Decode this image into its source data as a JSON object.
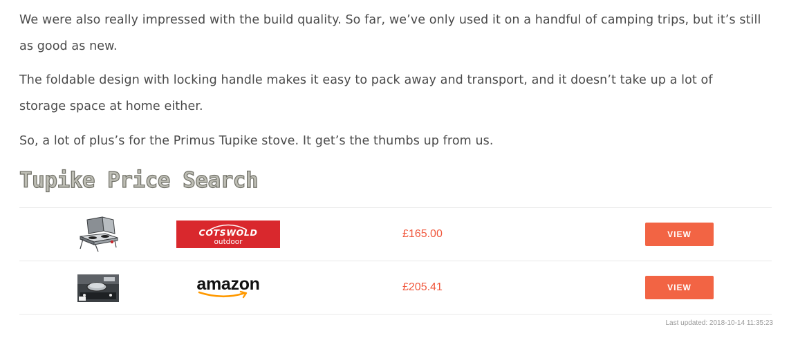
{
  "article": {
    "paragraphs": [
      "We were also really impressed with the build quality. So far, we’ve only used it on a handful of camping trips, but it’s still as good as new.",
      "The foldable design with locking handle makes it easy to pack away and transport, and it doesn’t take up a lot of storage space at home either.",
      "So, a lot of plus’s for the Primus Tupike stove. It get’s the thumbs up from us."
    ],
    "price_search_title": "Tupike Price Search"
  },
  "price_table": {
    "rows": [
      {
        "product_image": "primus-tupike-stove-icon",
        "retailer": "Cotswold Outdoor",
        "retailer_logo_main": "COTSWOLD",
        "retailer_logo_sub": "outdoor",
        "price": "£165.00",
        "button_label": "VIEW"
      },
      {
        "product_image": "stove-cooking-photo-icon",
        "retailer": "Amazon",
        "retailer_logo_main": "amazon",
        "price": "£205.41",
        "button_label": "VIEW"
      }
    ],
    "last_updated": "Last updated: 2018-10-14 11:35:23"
  },
  "colors": {
    "text": "#4a4a4a",
    "price": "#f0573c",
    "button": "#f26444",
    "cotswold_red": "#d9282d",
    "amazon_orange": "#ff9900",
    "divider": "#e8e8e8"
  }
}
